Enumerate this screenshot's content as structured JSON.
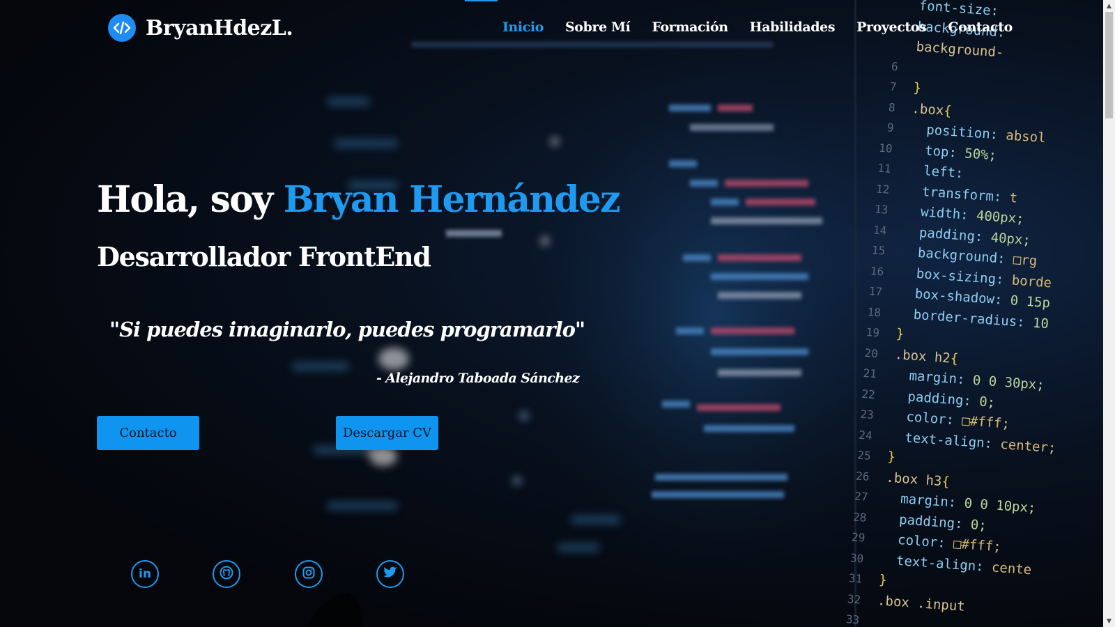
{
  "header": {
    "logo_text": "BryanHdezL.",
    "logo_icon": "code-icon",
    "nav": [
      {
        "label": "Inicio",
        "active": true
      },
      {
        "label": "Sobre Mí",
        "active": false
      },
      {
        "label": "Formación",
        "active": false
      },
      {
        "label": "Habilidades",
        "active": false
      },
      {
        "label": "Proyectos",
        "active": false
      },
      {
        "label": "Contacto",
        "active": false
      }
    ]
  },
  "hero": {
    "greeting": "Hola, soy ",
    "name": "Bryan Hernández",
    "subtitle": "Desarrollador FrontEnd",
    "quote": "\"Si puedes imaginarlo, puedes programarlo\"",
    "author": "- Alejandro Taboada Sánchez",
    "buttons": {
      "contact": "Contacto",
      "cv": "Descargar CV"
    }
  },
  "socials": [
    {
      "name": "linkedin-icon",
      "label": "in"
    },
    {
      "name": "github-icon"
    },
    {
      "name": "instagram-icon"
    },
    {
      "name": "twitter-icon"
    }
  ],
  "code_background": {
    "lines": [
      {
        "n": "",
        "t": "font-size: "
      },
      {
        "n": "",
        "t": "background: "
      },
      {
        "n": "",
        "t": "background-"
      },
      {
        "n": "6",
        "t": ""
      },
      {
        "n": "7",
        "t": "}"
      },
      {
        "n": "8",
        "t": ".box{"
      },
      {
        "n": "9",
        "t": "  position: absol"
      },
      {
        "n": "10",
        "t": "  top: 50%;"
      },
      {
        "n": "11",
        "t": "  left:"
      },
      {
        "n": "12",
        "t": "  transform: t"
      },
      {
        "n": "13",
        "t": "  width: 400px;"
      },
      {
        "n": "14",
        "t": "  padding: 40px;"
      },
      {
        "n": "15",
        "t": "  background: □rg"
      },
      {
        "n": "16",
        "t": "  box-sizing: borde"
      },
      {
        "n": "17",
        "t": "  box-shadow: 0 15p"
      },
      {
        "n": "18",
        "t": "  border-radius: 10"
      },
      {
        "n": "19",
        "t": "}"
      },
      {
        "n": "20",
        "t": ".box h2{"
      },
      {
        "n": "21",
        "t": "  margin: 0 0 30px;"
      },
      {
        "n": "22",
        "t": "  padding: 0;"
      },
      {
        "n": "23",
        "t": "  color: □#fff;"
      },
      {
        "n": "24",
        "t": "  text-align: center;"
      },
      {
        "n": "25",
        "t": "}"
      },
      {
        "n": "26",
        "t": ".box h3{"
      },
      {
        "n": "27",
        "t": "  margin: 0 0 10px;"
      },
      {
        "n": "28",
        "t": "  padding: 0;"
      },
      {
        "n": "29",
        "t": "  color: □#fff;"
      },
      {
        "n": "30",
        "t": "  text-align: cente"
      },
      {
        "n": "31",
        "t": "}"
      },
      {
        "n": "32",
        "t": ".box .input"
      },
      {
        "n": "33",
        "t": ""
      }
    ]
  },
  "colors": {
    "accent": "#1e9bf0",
    "background": "#05070d",
    "button": "#0f95f0",
    "text": "#ffffff"
  }
}
